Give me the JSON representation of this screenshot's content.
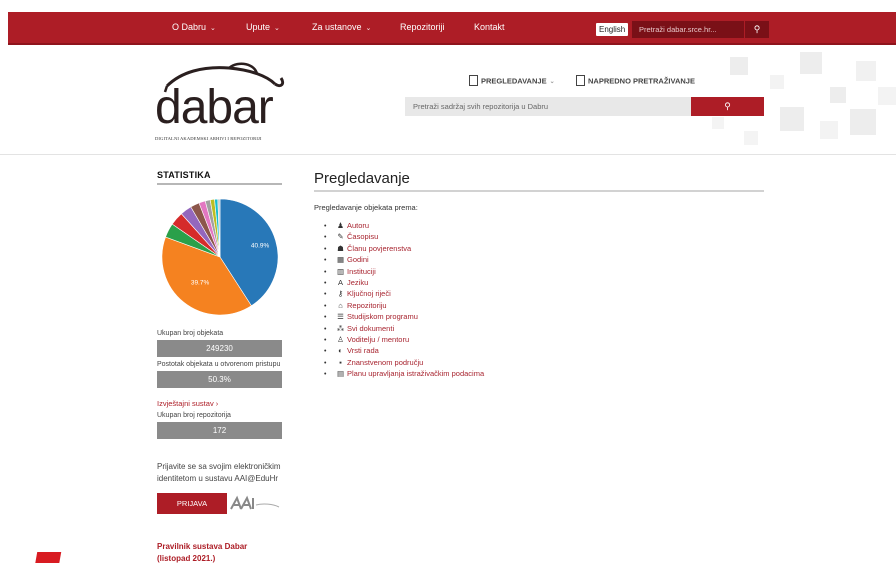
{
  "topbar": {
    "nav": [
      {
        "label": "O Dabru",
        "chevron": true
      },
      {
        "label": "Upute",
        "chevron": true
      },
      {
        "label": "Za ustanove",
        "chevron": true
      },
      {
        "label": "Repozitoriji",
        "chevron": false
      },
      {
        "label": "Kontakt",
        "chevron": false
      }
    ],
    "lang_label": "English",
    "search_placeholder": "Pretraži dabar.srce.hr...",
    "search_icon": "search-icon"
  },
  "header": {
    "logo_text": "dabar",
    "logo_subtitle": "DIGITALNI AKADEMSKI ARHIVI I REPOZITORIJI",
    "browse_label": "PREGLEDAVANJE",
    "advanced_label": "NAPREDNO PRETRAŽIVANJE",
    "search_placeholder": "Pretraži sadržaj svih repozitorija u Dabru",
    "search_icon": "search-icon"
  },
  "sidebar": {
    "title": "STATISTIKA",
    "chart_data": {
      "type": "pie",
      "slices": [
        {
          "label": "",
          "value": 40.9,
          "color": "#2878b8"
        },
        {
          "label": "",
          "value": 39.7,
          "color": "#f58220"
        },
        {
          "label": "",
          "value": 4.0,
          "color": "#2aa04a"
        },
        {
          "label": "",
          "value": 3.8,
          "color": "#d52b2b"
        },
        {
          "label": "",
          "value": 3.2,
          "color": "#9467bd"
        },
        {
          "label": "",
          "value": 2.5,
          "color": "#8c564b"
        },
        {
          "label": "",
          "value": 1.8,
          "color": "#e377c2"
        },
        {
          "label": "",
          "value": 1.4,
          "color": "#a0a0a0"
        },
        {
          "label": "",
          "value": 1.2,
          "color": "#bcbd22"
        },
        {
          "label": "",
          "value": 0.9,
          "color": "#17becf"
        },
        {
          "label": "",
          "value": 0.6,
          "color": "#c7c7c7"
        }
      ],
      "data_labels": [
        "40.9%",
        "39.7%"
      ]
    },
    "total_objects_label": "Ukupan broj objekata",
    "total_objects_value": "249230",
    "open_access_label": "Postotak objekata u otvorenom pristupu",
    "open_access_value": "50.3%",
    "reports_link": "Izvještajni sustav ›",
    "total_repos_label": "Ukupan broj repozitorija",
    "total_repos_value": "172",
    "login_text": "Prijavite se sa svojim elektroničkim identitetom u sustavu AAI@EduHr",
    "login_button": "PRIJAVA",
    "rules_link": "Pravilnik sustava Dabar (listopad 2021.)"
  },
  "content": {
    "title": "Pregledavanje",
    "subtitle": "Pregledavanje objekata prema:",
    "items": [
      {
        "icon": "user-icon",
        "glyph": "♟",
        "label": "Autoru"
      },
      {
        "icon": "journal-icon",
        "glyph": "✎",
        "label": "Časopisu"
      },
      {
        "icon": "group-icon",
        "glyph": "☗",
        "label": "Članu povjerenstva"
      },
      {
        "icon": "calendar-icon",
        "glyph": "▦",
        "label": "Godini"
      },
      {
        "icon": "institution-icon",
        "glyph": "▥",
        "label": "Instituciji"
      },
      {
        "icon": "language-icon",
        "glyph": "A",
        "label": "Jeziku"
      },
      {
        "icon": "key-icon",
        "glyph": "⚷",
        "label": "Ključnoj riječi"
      },
      {
        "icon": "repository-icon",
        "glyph": "⌂",
        "label": "Repozitoriju"
      },
      {
        "icon": "study-program-icon",
        "glyph": "☰",
        "label": "Studijskom programu"
      },
      {
        "icon": "sitemap-icon",
        "glyph": "⁂",
        "label": "Svi dokumenti"
      },
      {
        "icon": "mentor-icon",
        "glyph": "♙",
        "label": "Voditelju / mentoru"
      },
      {
        "icon": "type-icon",
        "glyph": "◐",
        "label": "Vrsti rada"
      },
      {
        "icon": "field-icon",
        "glyph": "▪",
        "label": "Znanstvenom području"
      },
      {
        "icon": "document-icon",
        "glyph": "▤",
        "label": "Planu upravljanja istraživačkim podacima"
      }
    ]
  }
}
